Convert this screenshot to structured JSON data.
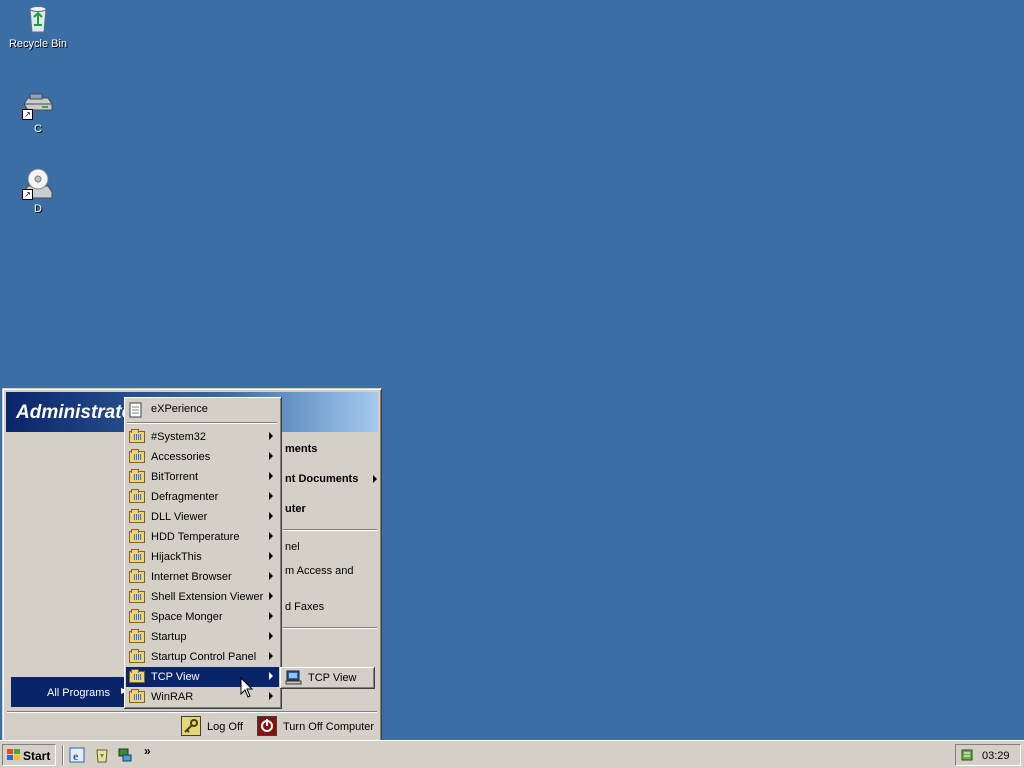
{
  "desktop": {
    "icons": [
      {
        "label": "Recycle Bin",
        "icon": "recycle-bin-icon"
      },
      {
        "label": "C",
        "icon": "hard-drive-shortcut-icon"
      },
      {
        "label": "D",
        "icon": "cd-drive-shortcut-icon"
      }
    ],
    "background_color": "#3a6ea5"
  },
  "start_menu": {
    "user": "Administrator",
    "right_items": [
      {
        "label": "My Documents",
        "visible_text": "ments",
        "bold": true
      },
      {
        "label": "My Recent Documents",
        "visible_text": "nt Documents",
        "bold": true,
        "has_submenu": true
      },
      {
        "label": "My Computer",
        "visible_text": "uter",
        "bold": true
      },
      {
        "label": "Control Panel",
        "visible_text": "nel"
      },
      {
        "label": "Set Program Access and Defaults",
        "visible_text": "m Access and"
      },
      {
        "label": "Printers and Faxes",
        "visible_text": "d Faxes"
      }
    ],
    "all_programs": "All Programs",
    "log_off": "Log Off",
    "turn_off": "Turn Off Computer"
  },
  "programs_menu": {
    "items": [
      {
        "label": "eXPerience",
        "type": "program",
        "icon": "document-icon"
      },
      {
        "label": "#System32",
        "type": "folder"
      },
      {
        "label": "Accessories",
        "type": "folder"
      },
      {
        "label": "BitTorrent",
        "type": "folder"
      },
      {
        "label": "Defragmenter",
        "type": "folder"
      },
      {
        "label": "DLL Viewer",
        "type": "folder"
      },
      {
        "label": "HDD Temperature",
        "type": "folder"
      },
      {
        "label": "HijackThis",
        "type": "folder"
      },
      {
        "label": "Internet Browser",
        "type": "folder"
      },
      {
        "label": "Shell Extension Viewer",
        "type": "folder"
      },
      {
        "label": "Space Monger",
        "type": "folder"
      },
      {
        "label": "Startup",
        "type": "folder"
      },
      {
        "label": "Startup Control Panel",
        "type": "folder"
      },
      {
        "label": "TCP View",
        "type": "folder",
        "selected": true
      },
      {
        "label": "WinRAR",
        "type": "folder"
      }
    ],
    "selection_color": "#0a246a"
  },
  "tcp_submenu": {
    "items": [
      {
        "label": "TCP View",
        "icon": "network-computer-icon"
      }
    ]
  },
  "taskbar": {
    "start_label": "Start",
    "quick_launch": [
      "ie-icon",
      "recycle-icon",
      "network-icon"
    ],
    "overflow": "»",
    "clock": "03:29"
  }
}
